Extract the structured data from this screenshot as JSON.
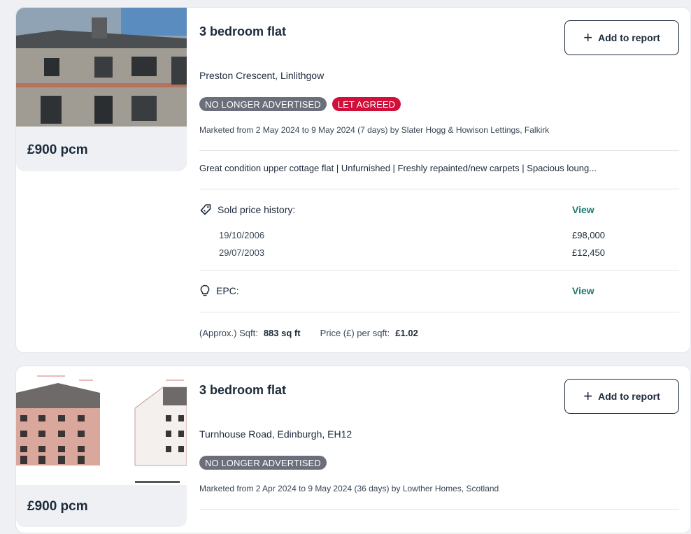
{
  "listings": [
    {
      "title": "3 bedroom flat",
      "add_label": "Add to report",
      "address": "Preston Crescent, Linlithgow",
      "price": "£900 pcm",
      "badges": {
        "status": "NO LONGER ADVERTISED",
        "let": "LET AGREED"
      },
      "marketed": "Marketed from 2 May 2024 to 9 May 2024 (7 days) by Slater Hogg & Howison Lettings, Falkirk",
      "description": "Great condition upper cottage flat | Unfurnished | Freshly repainted/new carpets | Spacious loung...",
      "sold_history": {
        "label": "Sold price history:",
        "view_label": "View",
        "entries": [
          {
            "date": "19/10/2006",
            "price": "£98,000"
          },
          {
            "date": "29/07/2003",
            "price": "£12,450"
          }
        ]
      },
      "epc": {
        "label": "EPC:",
        "view_label": "View"
      },
      "stats": {
        "sqft_label": "(Approx.) Sqft:",
        "sqft_value": "883 sq ft",
        "ppsf_label": "Price (£) per sqft:",
        "ppsf_value": "£1.02"
      }
    },
    {
      "title": "3 bedroom flat",
      "add_label": "Add to report",
      "address": "Turnhouse Road, Edinburgh, EH12",
      "price": "£900 pcm",
      "badges": {
        "status": "NO LONGER ADVERTISED"
      },
      "marketed": "Marketed from 2 Apr 2024 to 9 May 2024 (36 days) by Lowther Homes, Scotland"
    }
  ],
  "colors": {
    "badge_grey": "#6b6f7b",
    "badge_red": "#d0103a",
    "link_teal": "#1a7a72",
    "text_dark": "#1c2a3a"
  },
  "icons": [
    "plus-icon",
    "tag-icon",
    "lightbulb-icon"
  ]
}
